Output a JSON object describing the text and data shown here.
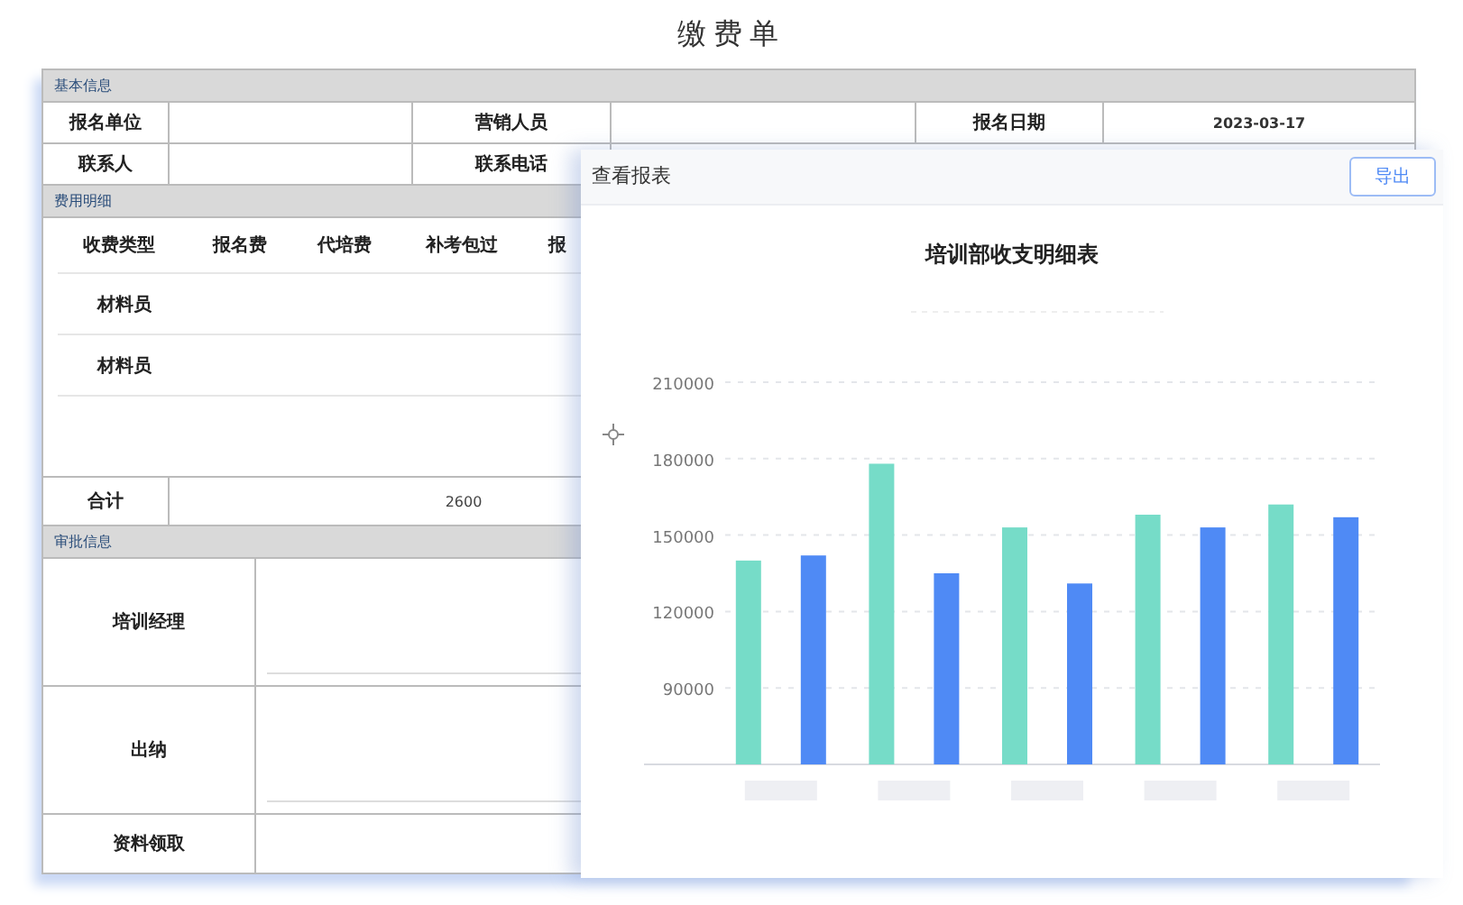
{
  "title": "缴费单",
  "basic_info": {
    "heading": "基本信息",
    "rows": [
      [
        {
          "label": "报名单位"
        },
        {
          "label": "营销人员"
        },
        {
          "label": "报名日期",
          "value": "2023-03-17"
        }
      ],
      [
        {
          "label": "联系人"
        },
        {
          "label": "联系电话"
        }
      ]
    ]
  },
  "fee_details": {
    "heading": "费用明细",
    "columns": [
      "收费类型",
      "报名费",
      "代培费",
      "补考包过",
      "报"
    ],
    "rows": [
      {
        "type": "材料员"
      },
      {
        "type": "材料员"
      }
    ],
    "total": {
      "label": "合计",
      "value": "2600"
    }
  },
  "approval": {
    "heading": "审批信息",
    "rows": [
      {
        "label": "培训经理",
        "kind": "signature"
      },
      {
        "label": "出纳",
        "kind": "signature"
      },
      {
        "label": "资料领取",
        "kind": "plain"
      }
    ]
  },
  "report_panel": {
    "title": "查看报表",
    "export_button": "导出",
    "chart_data": {
      "type": "bar",
      "title": "培训部收支明细表",
      "grid": true,
      "ylim": [
        60000,
        210000
      ],
      "yticks": [
        90000,
        120000,
        150000,
        180000,
        210000
      ],
      "series": [
        {
          "color": "#76dcc8",
          "values": [
            140000,
            178000,
            153000,
            158000,
            162000
          ]
        },
        {
          "color": "#4f8af5",
          "values": [
            142000,
            135000,
            131000,
            153000,
            157000
          ]
        }
      ]
    }
  }
}
